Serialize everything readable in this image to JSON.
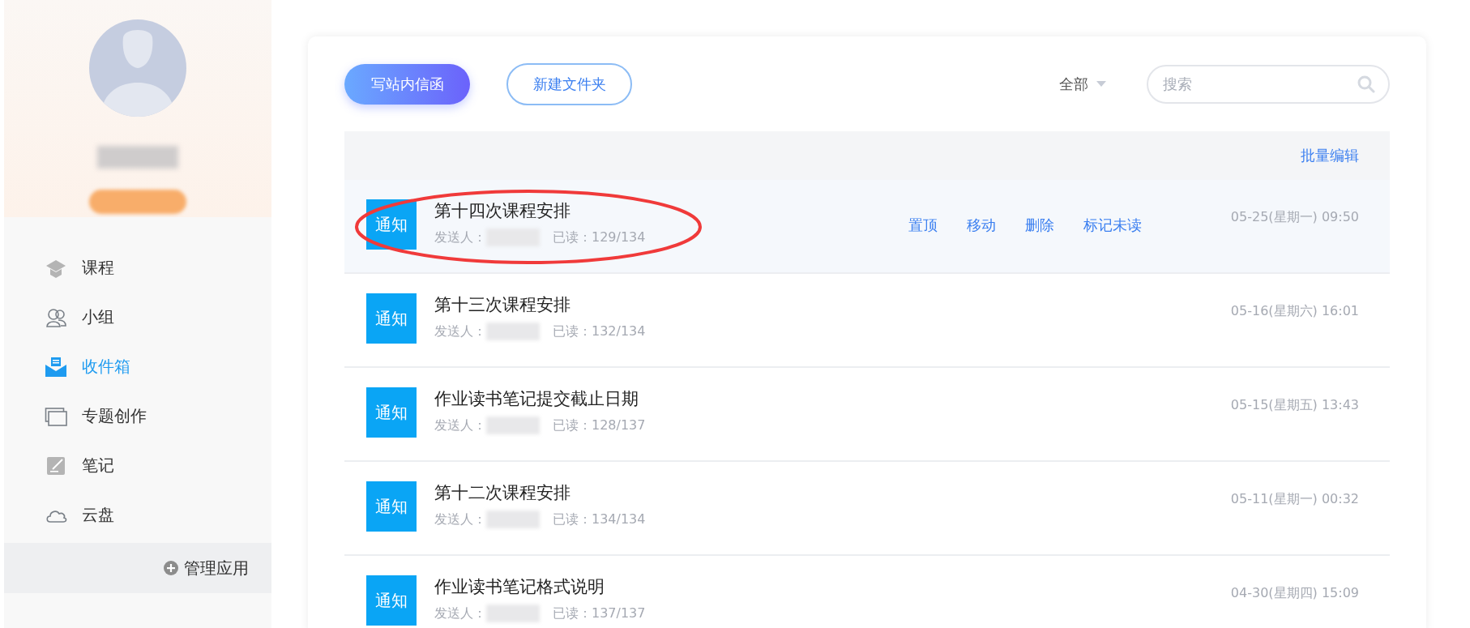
{
  "sidebar": {
    "items": [
      {
        "label": "课程",
        "selected": false
      },
      {
        "label": "小组",
        "selected": false
      },
      {
        "label": "收件箱",
        "selected": true
      },
      {
        "label": "专题创作",
        "selected": false
      },
      {
        "label": "笔记",
        "selected": false
      },
      {
        "label": "云盘",
        "selected": false
      }
    ],
    "manage": "管理应用"
  },
  "toolbar": {
    "compose": "写站内信函",
    "new_folder": "新建文件夹",
    "filter": "全部",
    "search": {
      "placeholder": "搜索"
    }
  },
  "batch_edit": "批量编辑",
  "messages": [
    {
      "badge": "通知",
      "title": "第十四次课程安排",
      "sender_label": "发送人：",
      "read": "已读：129/134",
      "date": "05-25(星期一) 09:50",
      "hovered": true,
      "circled": true,
      "actions": [
        "置顶",
        "移动",
        "删除",
        "标记未读"
      ]
    },
    {
      "badge": "通知",
      "title": "第十三次课程安排",
      "sender_label": "发送人：",
      "read": "已读：132/134",
      "date": "05-16(星期六) 16:01",
      "hovered": false,
      "circled": false
    },
    {
      "badge": "通知",
      "title": "作业读书笔记提交截止日期",
      "sender_label": "发送人：",
      "read": "已读：128/137",
      "date": "05-15(星期五) 13:43",
      "hovered": false,
      "circled": false
    },
    {
      "badge": "通知",
      "title": "第十二次课程安排",
      "sender_label": "发送人：",
      "read": "已读：134/134",
      "date": "05-11(星期一) 00:32",
      "hovered": false,
      "circled": false
    },
    {
      "badge": "通知",
      "title": "作业读书笔记格式说明",
      "sender_label": "发送人：",
      "read": "已读：137/137",
      "date": "04-30(星期四) 15:09",
      "hovered": false,
      "circled": false
    }
  ]
}
